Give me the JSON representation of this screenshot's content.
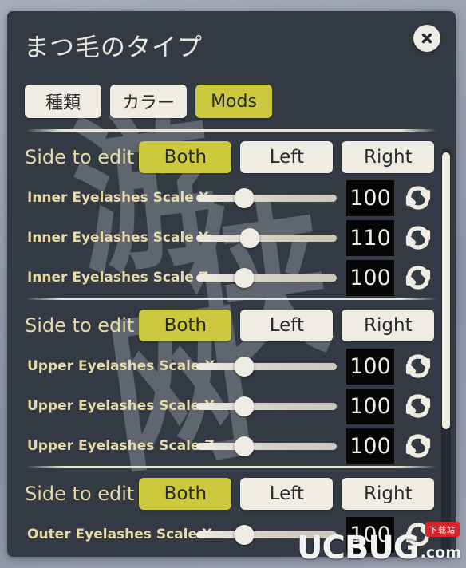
{
  "window": {
    "title": "まつ毛のタイプ",
    "close_icon": "close-icon"
  },
  "colors": {
    "accent": "#ccc93f",
    "panel_bg": "#333a44",
    "button_bg": "#efece3",
    "label_text": "#e8d9a8",
    "value_bg": "#050505",
    "value_text": "#efece3",
    "badge_red": "#d8262c"
  },
  "tabs": [
    {
      "label": "種類",
      "active": false
    },
    {
      "label": "カラー",
      "active": false
    },
    {
      "label": "Mods",
      "active": true
    }
  ],
  "sections": [
    {
      "side_to_edit": {
        "label": "Side to edit",
        "options": [
          {
            "label": "Both",
            "active": true
          },
          {
            "label": "Left",
            "active": false
          },
          {
            "label": "Right",
            "active": false
          }
        ]
      },
      "sliders": [
        {
          "label": "Inner Eyelashes Scale X",
          "value": "100",
          "percent": 34
        },
        {
          "label": "Inner Eyelashes Scale Y",
          "value": "110",
          "percent": 38
        },
        {
          "label": "Inner Eyelashes Scale Z",
          "value": "100",
          "percent": 34
        }
      ]
    },
    {
      "side_to_edit": {
        "label": "Side to edit",
        "options": [
          {
            "label": "Both",
            "active": true
          },
          {
            "label": "Left",
            "active": false
          },
          {
            "label": "Right",
            "active": false
          }
        ]
      },
      "sliders": [
        {
          "label": "Upper Eyelashes Scale X",
          "value": "100",
          "percent": 34
        },
        {
          "label": "Upper Eyelashes Scale Y",
          "value": "100",
          "percent": 34
        },
        {
          "label": "Upper Eyelashes Scale Z",
          "value": "100",
          "percent": 34
        }
      ]
    },
    {
      "side_to_edit": {
        "label": "Side to edit",
        "options": [
          {
            "label": "Both",
            "active": true
          },
          {
            "label": "Left",
            "active": false
          },
          {
            "label": "Right",
            "active": false
          }
        ]
      },
      "sliders": [
        {
          "label": "Outer Eyelashes Scale X",
          "value": "100",
          "percent": 34
        }
      ]
    }
  ],
  "scrollbar": {
    "thumb_top_pct": 1,
    "thumb_height_pct": 68
  },
  "watermark": {
    "glyphs": [
      "游",
      "侠",
      "网"
    ]
  },
  "site_watermark": {
    "main": "UCBUG",
    "suffix": ".com",
    "badge": "下载站"
  }
}
